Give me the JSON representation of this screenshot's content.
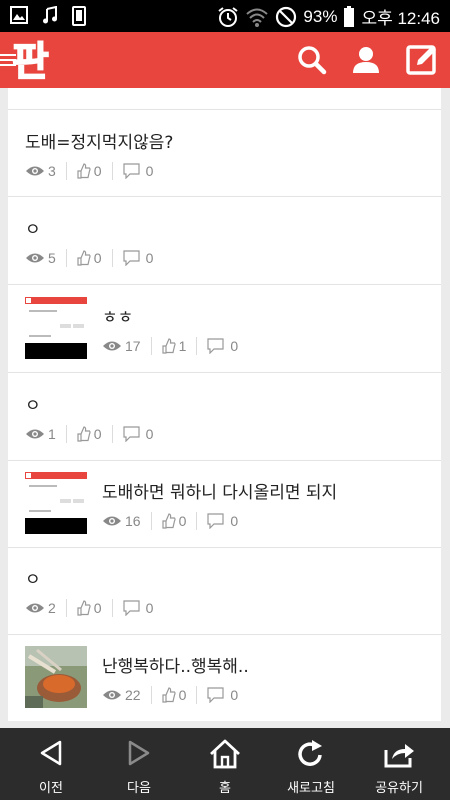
{
  "status_bar": {
    "battery": "93%",
    "time": "오후 12:46"
  },
  "app_bar": {
    "logo": "판"
  },
  "rows": [
    {
      "title": "도배=정지먹지않음?",
      "views": "3",
      "likes": "0",
      "comments": "0"
    },
    {
      "title": "ㅇ",
      "views": "5",
      "likes": "0",
      "comments": "0"
    },
    {
      "title": "ㅎㅎ",
      "views": "17",
      "likes": "1",
      "comments": "0"
    },
    {
      "title": "ㅇ",
      "views": "1",
      "likes": "0",
      "comments": "0"
    },
    {
      "title": "도배하면 뭐하니 다시올리면 되지",
      "views": "16",
      "likes": "0",
      "comments": "0"
    },
    {
      "title": "ㅇ",
      "views": "2",
      "likes": "0",
      "comments": "0"
    },
    {
      "title": "난행복하다..행복해..",
      "views": "22",
      "likes": "0",
      "comments": "0"
    }
  ],
  "nav": {
    "back": "이전",
    "forward": "다음",
    "home": "홈",
    "refresh": "새로고침",
    "share": "공유하기"
  }
}
